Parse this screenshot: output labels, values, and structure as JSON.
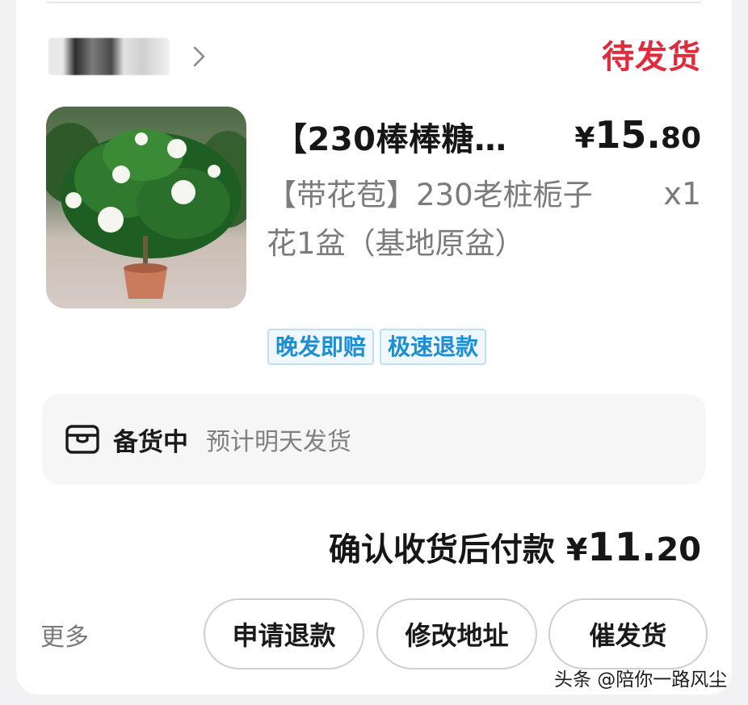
{
  "shop": {
    "name": ""
  },
  "order": {
    "status": "待发货"
  },
  "product": {
    "title": "【230棒棒糖…",
    "price_yen": "¥",
    "price_int": "15.",
    "price_dec": "80",
    "spec": "【带花苞】230老桩栀子花1盆（基地原盆）",
    "quantity": "x1",
    "tags": [
      "晚发即赔",
      "极速退款"
    ]
  },
  "logistics": {
    "title": "备货中",
    "description": "预计明天发货"
  },
  "payment": {
    "label": "确认收货后付款",
    "amount_yen": "¥",
    "amount_int": "11.",
    "amount_dec": "20"
  },
  "actions": {
    "more_label": "更多",
    "refund_label": "申请退款",
    "address_label": "修改地址",
    "urge_label": "催发货"
  },
  "watermark": "头条 @陪你一路风尘",
  "colors": {
    "status_red": "#e02b3c",
    "tag_blue": "#1b8fd1",
    "text_dark": "#161616",
    "text_gray": "#7b7b7b"
  },
  "icons": {
    "shop_chevron": "chevron-right-icon",
    "logistics": "box-icon"
  }
}
